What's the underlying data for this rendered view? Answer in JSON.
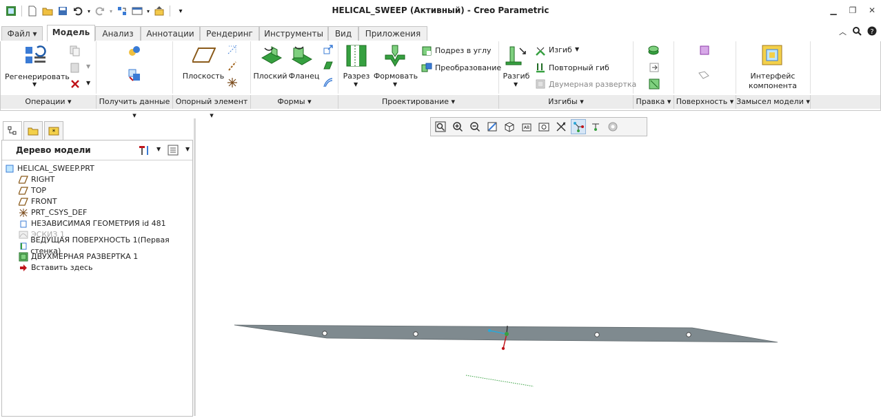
{
  "window": {
    "title": "HELICAL_SWEEP (Активный) - Creo Parametric"
  },
  "tabs": [
    {
      "label": "Файл ▾"
    },
    {
      "label": "Модель"
    },
    {
      "label": "Анализ"
    },
    {
      "label": "Аннотации"
    },
    {
      "label": "Рендеринг"
    },
    {
      "label": "Инструменты"
    },
    {
      "label": "Вид"
    },
    {
      "label": "Приложения"
    }
  ],
  "ribbon": {
    "operations": {
      "regenerate": "Регенерировать",
      "label": "Операции ▾"
    },
    "get_data": {
      "label": "Получить данные ▾"
    },
    "datum": {
      "plane": "Плоскость",
      "label": "Опорный элемент ▾"
    },
    "shapes": {
      "flat": "Плоский",
      "flange": "Фланец",
      "label": "Формы ▾"
    },
    "design": {
      "cut": "Разрез",
      "form": "Формовать",
      "corner_relief": "Подрез в углу",
      "transform": "Преобразование",
      "label": "Проектирование ▾"
    },
    "bends": {
      "unbend": "Разгиб",
      "bend": "Изгиб",
      "bend_back": "Повторный гиб",
      "flat_pattern": "Двумерная развертка",
      "label": "Изгибы ▾"
    },
    "edit": {
      "label": "Правка ▾"
    },
    "surface": {
      "label": "Поверхность ▾"
    },
    "design_intent": {
      "component_interface": "Интерфейс компонента",
      "label": "Замысел модели ▾"
    }
  },
  "model_tree": {
    "title": "Дерево модели",
    "items": [
      {
        "label": "HELICAL_SWEEP.PRT",
        "icon": "part-icon"
      },
      {
        "label": "RIGHT",
        "icon": "datum-plane-icon"
      },
      {
        "label": "TOP",
        "icon": "datum-plane-icon"
      },
      {
        "label": "FRONT",
        "icon": "datum-plane-icon"
      },
      {
        "label": "PRT_CSYS_DEF",
        "icon": "csys-icon"
      },
      {
        "label": "НЕЗАВИСИМАЯ ГЕОМЕТРИЯ id 481",
        "icon": "geometry-icon"
      },
      {
        "label": "ЭСКИЗ 1",
        "icon": "sketch-icon"
      },
      {
        "label": "ВЕДУЩАЯ ПОВЕРХНОСТЬ 1(Первая стенка)",
        "icon": "sheetmetal-wall-icon"
      },
      {
        "label": "ДВУХМЕРНАЯ РАЗВЕРТКА 1",
        "icon": "flat-pattern-icon"
      },
      {
        "label": "Вставить здесь",
        "icon": "insert-here-arrow-icon"
      }
    ]
  },
  "colors": {
    "accent": "#2f78c4",
    "tab_bg": "#f0f0f0",
    "model_gray": "#7f8a8f"
  }
}
